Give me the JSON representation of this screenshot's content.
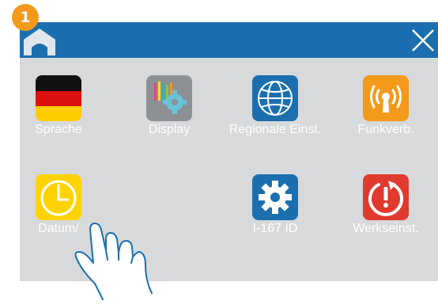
{
  "step": {
    "number": "1"
  },
  "titlebar": {
    "home_icon": "home-icon",
    "close_icon": "close-icon",
    "color": "#1b6fae"
  },
  "screen_background": "#d7d9db",
  "tiles": [
    {
      "label": "Sprache",
      "icon": "german-flag-icon"
    },
    {
      "label": "Display",
      "icon": "display-settings-icon"
    },
    {
      "label": "Regionale Einst.",
      "icon": "globe-icon"
    },
    {
      "label": "Funkverb.",
      "icon": "wireless-signal-icon"
    },
    {
      "label": "Datum/",
      "icon": "clock-icon"
    },
    {
      "label": "I-167 ID",
      "icon": "gear-icon"
    },
    {
      "label": "Werkseinst.",
      "icon": "factory-reset-icon"
    }
  ],
  "colors": {
    "accent_orange": "#f39a1a",
    "globe_blue": "#1b6fae",
    "clock_yellow": "#ffd200",
    "reset_red": "#e03a2f"
  },
  "pointer": {
    "icon": "tap-hand-icon"
  }
}
